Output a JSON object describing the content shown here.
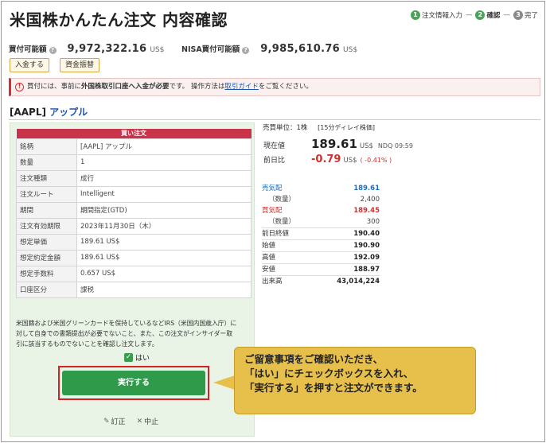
{
  "page": {
    "title": "米国株かんたん注文 内容確認"
  },
  "steps": [
    {
      "num": "1",
      "label": "注文情報入力"
    },
    {
      "num": "2",
      "label": "確認"
    },
    {
      "num": "3",
      "label": "完了"
    }
  ],
  "balances": {
    "buying_power_label": "買付可能額",
    "buying_power_value": "9,972,322.16",
    "nisa_label": "NISA買付可能額",
    "nisa_value": "9,985,610.76",
    "unit": "US$",
    "help_icon": "?"
  },
  "buttons": {
    "deposit": "入金する",
    "transfer": "資金振替",
    "execute": "実行する",
    "edit": "訂正",
    "cancel": "中止"
  },
  "notice": {
    "icon": "!",
    "text_before": "買付には、事前に",
    "text_bold": "外国株取引口座へ入金が必要",
    "text_middle": "です。 操作方法は",
    "link": "取引ガイド",
    "text_after": "をご覧ください。"
  },
  "stock": {
    "code": "[AAPL]",
    "name": "アップル"
  },
  "order": {
    "header": "買い注文",
    "rows": [
      {
        "k": "銘柄",
        "v": "[AAPL] アップル"
      },
      {
        "k": "数量",
        "v": "1"
      },
      {
        "k": "注文種類",
        "v": "成行"
      },
      {
        "k": "注文ルート",
        "v": "Intelligent"
      },
      {
        "k": "期間",
        "v": "期間指定(GTD)"
      },
      {
        "k": "注文有効期限",
        "v": "2023年11月30日（木）"
      },
      {
        "k": "想定単価",
        "v": "189.61 US$"
      },
      {
        "k": "想定約定金額",
        "v": "189.61 US$"
      },
      {
        "k": "想定手数料",
        "v": "0.657 US$"
      },
      {
        "k": "口座区分",
        "v": "課税"
      }
    ],
    "note_lines": [
      "米国籍および米国グリーンカードを保持しているなどIRS（米国内国歳入庁）に",
      "対して自身での書類提出が必要でないこと、また、この注文がインサイダー取",
      "引に該当するものでないことを確認し注文します。"
    ],
    "confirm_label": "はい",
    "confirm_mark": "✓",
    "edit_icon": "✎",
    "cancel_icon": "✕"
  },
  "quote": {
    "unit_text": "売買単位：1株",
    "delay_text": "[15分ディレイ株価]",
    "current_label": "現在値",
    "current_value": "189.61",
    "current_unit": "US$",
    "current_meta": "NDQ 09:59",
    "change_label": "前日比",
    "change_value": "-0.79",
    "change_unit": "US$",
    "change_pct": "( -0.41% )",
    "ask_label": "売気配",
    "ask_value": "189.61",
    "ask_qty_label": "（数量）",
    "ask_qty": "2,400",
    "bid_label": "買気配",
    "bid_value": "189.45",
    "bid_qty_label": "（数量）",
    "bid_qty": "300",
    "prev_close_label": "前日終値",
    "prev_close": "190.40",
    "open_label": "始値",
    "open": "190.90",
    "high_label": "高値",
    "high": "192.09",
    "low_label": "安値",
    "low": "188.97",
    "volume_label": "出来高",
    "volume": "43,014,224"
  },
  "callout": {
    "line1": "ご留意事項をご確認いただき、",
    "line2": "「はい」にチェックボックスを入れ、",
    "line3": "「実行する」を押すと注文ができます。"
  },
  "colors": {
    "primary_green": "#2e9a4a",
    "accent_red": "#d32f2f",
    "panel_green": "#e9f3e6",
    "order_header": "#c9344a",
    "callout": "#e6c04a",
    "link_blue": "#1a56b0"
  }
}
